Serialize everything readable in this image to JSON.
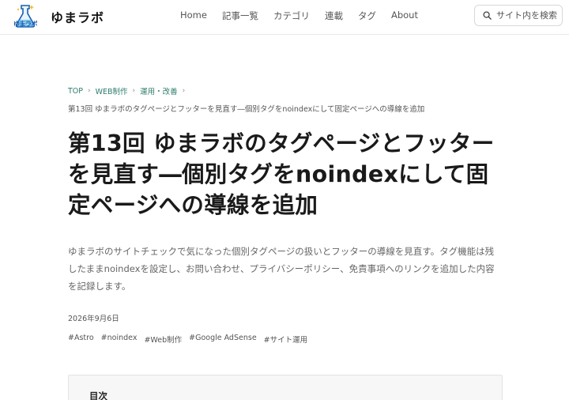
{
  "header": {
    "logo_text": "ゆまラボ",
    "site_name": "ゆまラボ",
    "nav": [
      "Home",
      "記事一覧",
      "カテゴリ",
      "連載",
      "タグ",
      "About"
    ],
    "search_placeholder": "サイト内を検索"
  },
  "breadcrumb": [
    "TOP",
    "WEB制作",
    "運用・改善"
  ],
  "current_page": "第13回 ゆまラボのタグページとフッターを見直す―個別タグをnoindexにして固定ページへの導線を追加",
  "article": {
    "title": "第13回 ゆまラボのタグページとフッターを見直す―個別タグをnoindexにして固定ページへの導線を追加",
    "lead": "ゆまラボのサイトチェックで気になった個別タグページの扱いとフッターの導線を見直す。タグ機能は残したままnoindexを設定し、お問い合わせ、プライバシーポリシー、免責事項へのリンクを追加した内容を記録します。",
    "date": "2026年9月6日",
    "tags": [
      "#Astro",
      "#noindex",
      "#Web制作",
      "#Google AdSense",
      "#サイト運用"
    ]
  },
  "toc": {
    "title": "目次"
  },
  "colors": {
    "accent": "#2e7d6b",
    "logo_blue": "#1a5fb4"
  }
}
